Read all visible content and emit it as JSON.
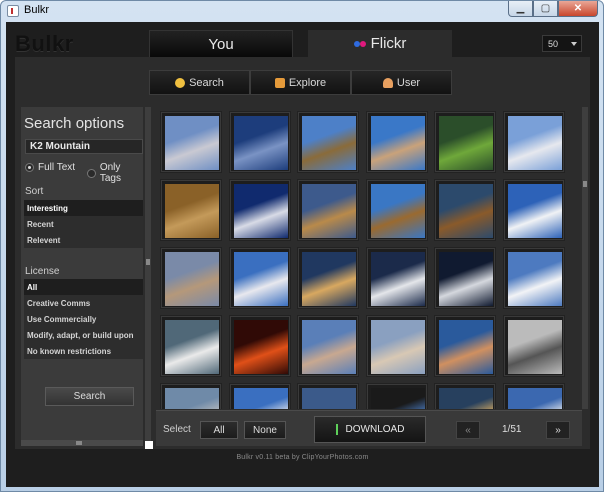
{
  "window": {
    "title": "Bulkr",
    "close_glyph": "✕",
    "min_glyph": "▁",
    "max_glyph": "▢"
  },
  "app": {
    "logo": "Bulkr"
  },
  "top_tabs": [
    {
      "label": "You"
    },
    {
      "label": "Flickr",
      "dot_colors": [
        "#2f6be0",
        "#e0197d"
      ]
    }
  ],
  "per_page": {
    "value": "50"
  },
  "sub_tabs": [
    {
      "label": "Search",
      "icon": "magnifier-icon",
      "icon_color": "#f0c040"
    },
    {
      "label": "Explore",
      "icon": "explore-icon",
      "icon_color": "#e59a3a"
    },
    {
      "label": "User",
      "icon": "user-icon",
      "icon_color": "#e8a060"
    }
  ],
  "sidebar": {
    "title": "Search options",
    "query": "K2 Mountain",
    "radio_full_text": "Full Text",
    "radio_only_tags": "Only Tags",
    "sort_label": "Sort",
    "sort_items": [
      "Interesting",
      "Recent",
      "Relevent"
    ],
    "license_label": "License",
    "license_items": [
      "All",
      "Creative Comms",
      "Use Commercially",
      "Modify, adapt, or build upon",
      "No known restrictions"
    ],
    "search_button": "Search"
  },
  "photos": [
    [
      "#6f8fc4",
      "#c9c9d2"
    ],
    [
      "#1d3d7c",
      "#7a93c4"
    ],
    [
      "#4d80c8",
      "#8a6b3a"
    ],
    [
      "#3a78c8",
      "#c9a27a"
    ],
    [
      "#2b4e2a",
      "#6fa83a"
    ],
    [
      "#7aa0d8",
      "#e6e8ee"
    ],
    [
      "#8a6128",
      "#c49a5a"
    ],
    [
      "#102a6e",
      "#d8dbe6"
    ],
    [
      "#3d5a8c",
      "#b98a4a"
    ],
    [
      "#3a77c4",
      "#9a6a30"
    ],
    [
      "#2c4a6c",
      "#8a5a2a"
    ],
    [
      "#2d62b8",
      "#f0f2f5"
    ],
    [
      "#7a8aa8",
      "#b5987a"
    ],
    [
      "#3a6fc0",
      "#e8e8ee"
    ],
    [
      "#203860",
      "#d8a860"
    ],
    [
      "#1b2a4a",
      "#e4e6ea"
    ],
    [
      "#101a30",
      "#d5d8de"
    ],
    [
      "#4d7ac0",
      "#f2f3f6"
    ],
    [
      "#506878",
      "#eaeaea"
    ],
    [
      "#300a06",
      "#e05018"
    ],
    [
      "#5a7fb8",
      "#c8a890"
    ],
    [
      "#8aa0c0",
      "#d8c8b4"
    ],
    [
      "#2a5a9c",
      "#d09060"
    ],
    [
      "#bbbbbb",
      "#555555"
    ],
    [
      "#6f8aa8",
      "#c0c0c0"
    ],
    [
      "#3a6fc0",
      "#e8e8ee"
    ],
    [
      "#3b5a8a",
      "#3b5a8a"
    ],
    [
      "#1a1a1a",
      "#4d80c8"
    ],
    [
      "#27405e",
      "#e0b060"
    ],
    [
      "#3b68b0",
      "#f0f0f0"
    ]
  ],
  "bottom_bar": {
    "select_label": "Select",
    "all_button": "All",
    "none_button": "None",
    "download_button": "DOWNLOAD",
    "prev_button": "«",
    "next_button": "»",
    "page_indicator": "1/51"
  },
  "footer": {
    "text": "Bulkr v0.11 beta by   ClipYourPhotos.com"
  }
}
